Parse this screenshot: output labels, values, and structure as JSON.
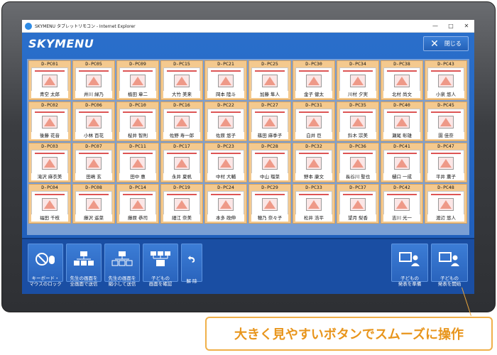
{
  "window": {
    "title": "SKYMENU タブレットリモコン - Internet Explorer",
    "controls": [
      "—",
      "□",
      "✕"
    ]
  },
  "app": {
    "logo": "SKYMENU",
    "close_label": "閉じる"
  },
  "tiles": [
    {
      "id": "D-PC01",
      "name": "青空 太郎"
    },
    {
      "id": "D-PC05",
      "name": "井川 緑乃"
    },
    {
      "id": "D-PC09",
      "name": "植田 章二"
    },
    {
      "id": "D-PC15",
      "name": "大竹 美来"
    },
    {
      "id": "D-PC21",
      "name": "岡本 陸斗"
    },
    {
      "id": "D-PC25",
      "name": "加藤 隼人"
    },
    {
      "id": "D-PC30",
      "name": "金子 健太"
    },
    {
      "id": "D-PC34",
      "name": "川村 夕実"
    },
    {
      "id": "D-PC38",
      "name": "北村 尚文"
    },
    {
      "id": "D-PC43",
      "name": "小泉 悠人"
    },
    {
      "id": "D-PC02",
      "name": "後藤 花音"
    },
    {
      "id": "D-PC06",
      "name": "小林 百花"
    },
    {
      "id": "D-PC10",
      "name": "桜井 智則"
    },
    {
      "id": "D-PC16",
      "name": "佐野 寿一郎"
    },
    {
      "id": "D-PC22",
      "name": "佐原 悠子"
    },
    {
      "id": "D-PC27",
      "name": "篠田 麻季子"
    },
    {
      "id": "D-PC31",
      "name": "白井 巨"
    },
    {
      "id": "D-PC35",
      "name": "鈴木 宗美"
    },
    {
      "id": "D-PC40",
      "name": "瀬尾 彰雄"
    },
    {
      "id": "D-PC45",
      "name": "園 佳奈"
    },
    {
      "id": "D-PC03",
      "name": "滝沢 麻衣美"
    },
    {
      "id": "D-PC07",
      "name": "田嶋 玄"
    },
    {
      "id": "D-PC11",
      "name": "田中 惠"
    },
    {
      "id": "D-PC17",
      "name": "永井 夏帆"
    },
    {
      "id": "D-PC23",
      "name": "中村 大輔"
    },
    {
      "id": "D-PC28",
      "name": "中山 瑠菜"
    },
    {
      "id": "D-PC32",
      "name": "野本 康文"
    },
    {
      "id": "D-PC36",
      "name": "長谷川 聖也"
    },
    {
      "id": "D-PC41",
      "name": "樋口 一成"
    },
    {
      "id": "D-PC47",
      "name": "平井 薫子"
    },
    {
      "id": "D-PC04",
      "name": "福田 千枝"
    },
    {
      "id": "D-PC08",
      "name": "藤沢 遥菜"
    },
    {
      "id": "D-PC14",
      "name": "藤原 恭司"
    },
    {
      "id": "D-PC19",
      "name": "細江 奈美"
    },
    {
      "id": "D-PC24",
      "name": "本多 政伸"
    },
    {
      "id": "D-PC29",
      "name": "穂乃 奈々子"
    },
    {
      "id": "D-PC33",
      "name": "松井 浩平"
    },
    {
      "id": "D-PC37",
      "name": "望月 梨香"
    },
    {
      "id": "D-PC42",
      "name": "吉川 光一"
    },
    {
      "id": "D-PC48",
      "name": "渡辺 悠人"
    }
  ],
  "toolbar": {
    "lock": "キーボード・\nマウスのロック",
    "send_full": "先生の画面を\n全画面で送信",
    "send_small": "先生の画面を\n縮小して送信",
    "check": "子どもの\n画面を確認",
    "undo": "解 除",
    "prepare": "子どもの\n発表を準備",
    "present": "子どもの\n発表を開始"
  },
  "callout": "大きく見やすいボタンでスムーズに操作"
}
